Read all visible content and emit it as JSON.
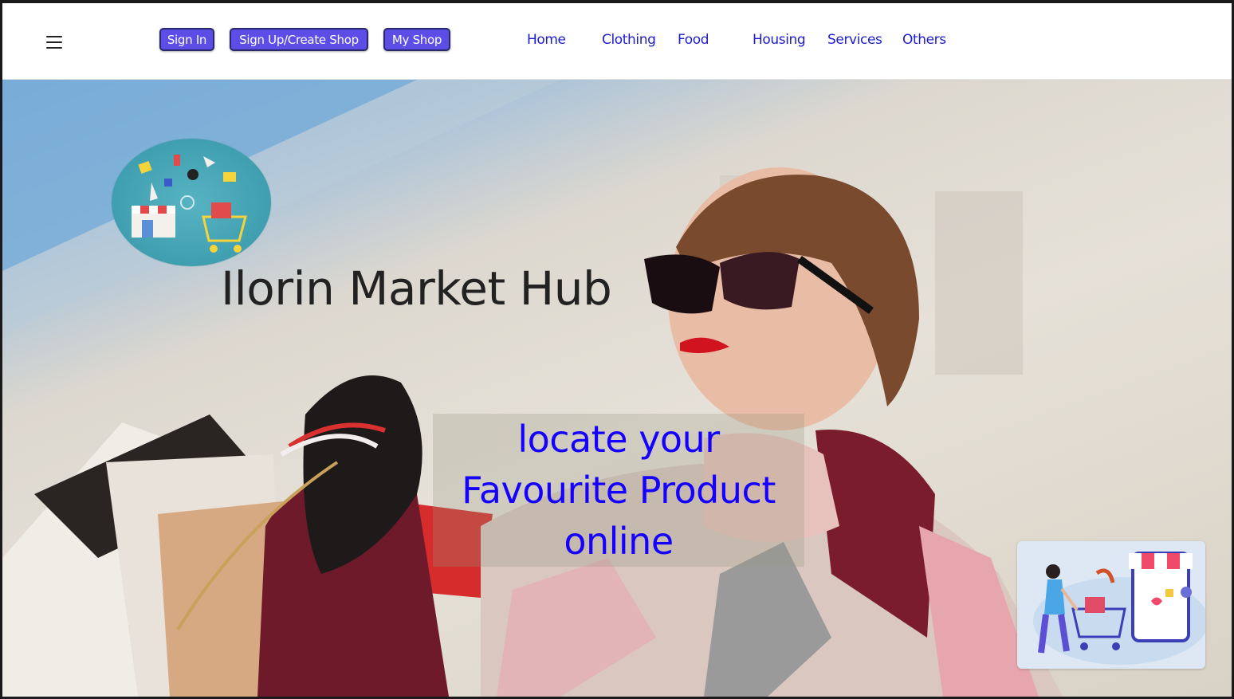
{
  "navbar": {
    "menu_icon": "hamburger-menu-icon",
    "buttons": {
      "sign_in": "Sign In",
      "sign_up": "Sign Up/Create Shop",
      "my_shop": "My Shop"
    },
    "links": [
      "Home",
      "Clothing",
      "Food",
      "Housing",
      "Services",
      "Others"
    ]
  },
  "hero": {
    "title": "Ilorin Market Hub",
    "tagline": [
      "locate your",
      "Favourite Product",
      "online"
    ],
    "logo_image": "shopping-collage-logo",
    "promo_image": "online-shopping-illustration"
  },
  "colors": {
    "button_bg": "#5b4de6",
    "link": "#1d1dcc",
    "tagline": "#1500ff",
    "title": "#222222"
  }
}
